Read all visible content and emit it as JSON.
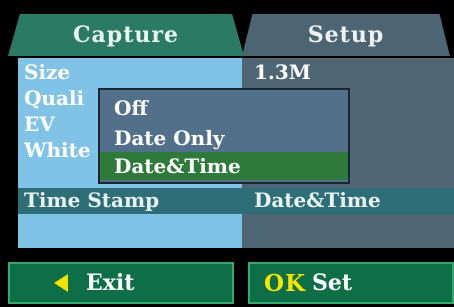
{
  "tabs": [
    {
      "label": "Capture"
    },
    {
      "label": "Setup"
    }
  ],
  "settings": {
    "rows": [
      {
        "label": "Size",
        "value": "1.3M"
      },
      {
        "label": "Quali",
        "value": ""
      },
      {
        "label": "EV",
        "value": ""
      },
      {
        "label": "White",
        "value": ""
      },
      {
        "label": "Time Stamp",
        "value": "Date&Time"
      }
    ]
  },
  "popup": {
    "options": [
      {
        "label": "Off"
      },
      {
        "label": "Date Only"
      },
      {
        "label": "Date&Time"
      }
    ],
    "selected": "Date&Time"
  },
  "footer": {
    "exit_label": "Exit",
    "ok_label": "OK",
    "set_label": "Set"
  },
  "colors": {
    "tab_active": "#2a7a64",
    "tab_inactive": "#4d6472",
    "left_column": "#81c3e6",
    "selection_bar": "#2e6e76",
    "popup_bg": "#53708a",
    "popup_selected": "#2d7a3a",
    "button_bg": "#0e6e48",
    "ok_yellow": "#f7e400"
  }
}
